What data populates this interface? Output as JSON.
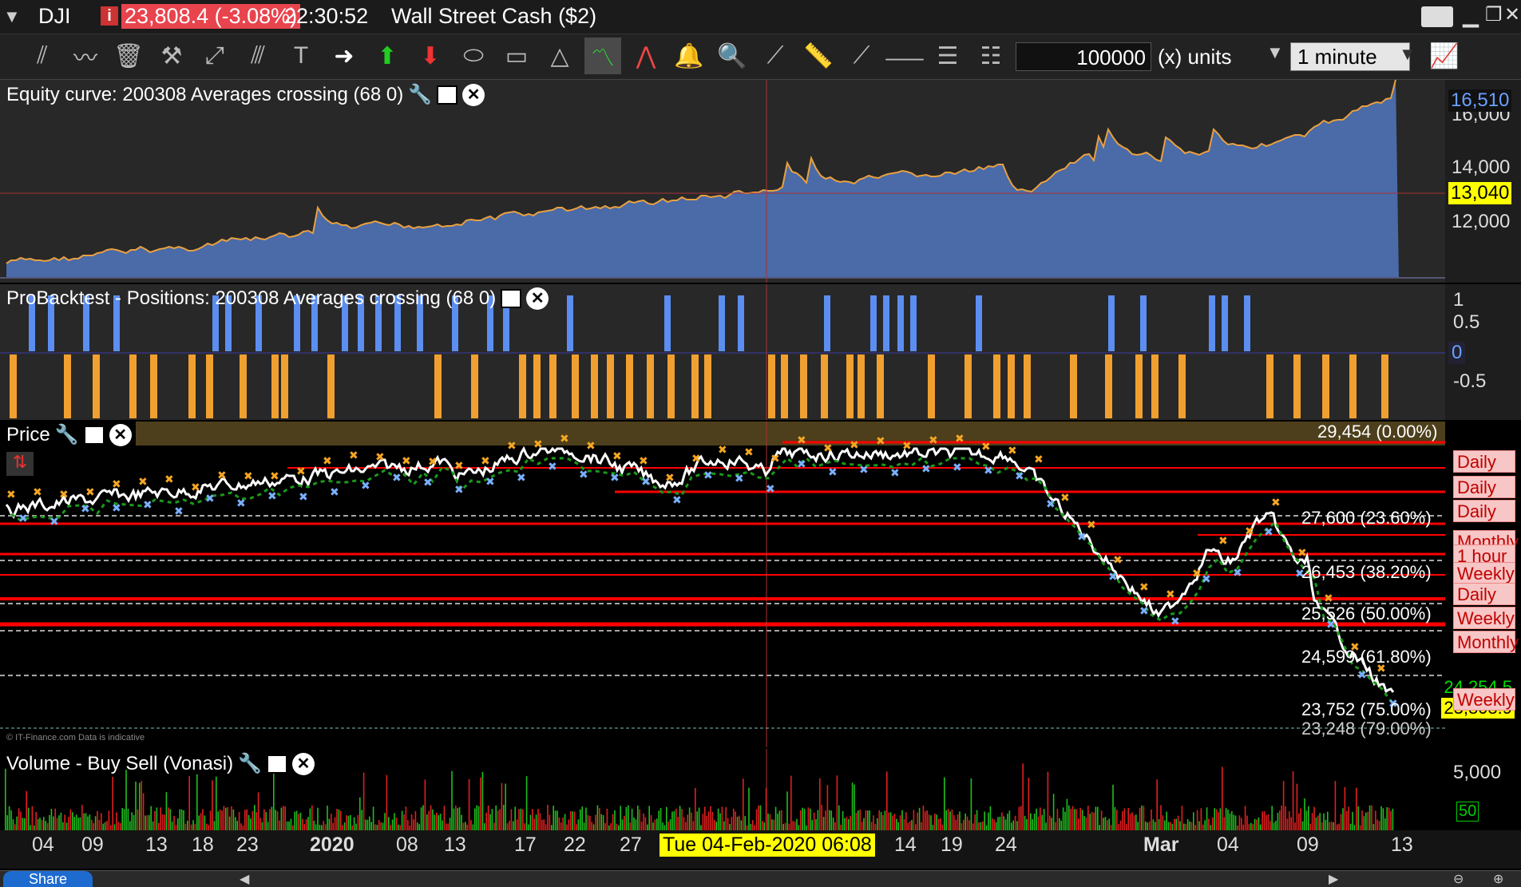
{
  "titlebar": {
    "symbol": "DJI",
    "price_change": "23,808.4 (-3.08%)",
    "time": "22:30:52",
    "instrument": "Wall Street Cash ($2)"
  },
  "toolbar": {
    "quantity": "100000",
    "units": "(x) units",
    "timeframe": "1 minute"
  },
  "equity_panel": {
    "title": "Equity curve: 200308 Averages crossing (68 0)",
    "y_ticks": [
      "16,000",
      "14,000",
      "12,000"
    ],
    "last_value": "16,510",
    "crosshair_value": "13,040"
  },
  "positions_panel": {
    "title": "ProBacktest - Positions: 200308 Averages crossing (68 0)",
    "y_ticks": [
      "1",
      "0.5",
      "-0.5"
    ],
    "zero_tag": "0"
  },
  "price_panel": {
    "title": "Price",
    "price_tags": {
      "current": "23,808.9",
      "ma": "24,254.5"
    },
    "levels": [
      {
        "label": "Daily"
      },
      {
        "label": "Daily"
      },
      {
        "label": "Daily"
      },
      {
        "label": "Monthly"
      },
      {
        "label": "1 hour"
      },
      {
        "label": "Weekly"
      },
      {
        "label": "Daily"
      },
      {
        "label": "Weekly"
      },
      {
        "label": "Monthly"
      },
      {
        "label": "Weekly"
      }
    ],
    "fib_levels": [
      "29,454 (0.00%)",
      "27,600 (23.60%)",
      "26,453 (38.20%)",
      "25,526 (50.00%)",
      "24,599 (61.80%)",
      "23,752 (75.00%)",
      "23,248 (79.00%)"
    ],
    "copyright": "© IT-Finance.com Data is indicative"
  },
  "volume_panel": {
    "title": "Volume - Buy Sell (Vonasi)",
    "y_ticks": [
      "5,000"
    ],
    "last_tag": "50"
  },
  "x_axis": {
    "labels": [
      "04",
      "09",
      "13",
      "18",
      "23",
      "2020",
      "08",
      "13",
      "17",
      "22",
      "27",
      "14",
      "19",
      "24",
      "Mar",
      "04",
      "09",
      "13"
    ],
    "crosshair_label": "Tue 04-Feb-2020 06:08"
  },
  "bottombar": {
    "share_label": "Share"
  },
  "colors": {
    "equity_fill": "#4a6aa8",
    "equity_line": "#e8a040",
    "long_bar": "#5b8ef0",
    "short_bar": "#f0a030",
    "level_line": "#ff0000",
    "crosshair": "#ffff00"
  }
}
